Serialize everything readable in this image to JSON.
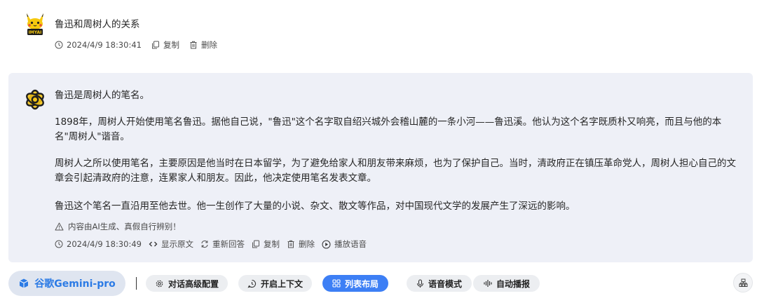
{
  "user_message": {
    "avatar_badge": "IMYAI",
    "question": "鲁迅和周树人的关系",
    "timestamp": "2024/4/9 18:30:41",
    "copy_label": "复制",
    "delete_label": "删除"
  },
  "answer": {
    "paragraphs": [
      "鲁迅是周树人的笔名。",
      "1898年，周树人开始使用笔名鲁迅。据他自己说，\"鲁迅\"这个名字取自绍兴城外会稽山麓的一条小河——鲁迅溪。他认为这个名字既质朴又响亮，而且与他的本名\"周树人\"谐音。",
      "周树人之所以使用笔名，主要原因是他当时在日本留学，为了避免给家人和朋友带来麻烦，也为了保护自己。当时，清政府正在镇压革命党人，周树人担心自己的文章会引起清政府的注意，连累家人和朋友。因此，他决定使用笔名发表文章。",
      "鲁迅这个笔名一直沿用至他去世。他一生创作了大量的小说、杂文、散文等作品，对中国现代文学的发展产生了深远的影响。"
    ],
    "disclaimer": "内容由AI生成、真假自行辨别！",
    "timestamp": "2024/4/9 18:30:49",
    "show_source_label": "显示原文",
    "regenerate_label": "重新回答",
    "copy_label": "复制",
    "delete_label": "删除",
    "play_voice_label": "播放语音"
  },
  "toolbar": {
    "model_label": "谷歌Gemini-pro",
    "config_label": "对话高级配置",
    "context_label": "开启上下文",
    "layout_label": "列表布局",
    "voice_mode_label": "语音模式",
    "autoplay_label": "自动播报"
  },
  "colors": {
    "accent": "#3d7ff5",
    "model_text": "#2c7be5",
    "card_bg": "#eef0f7",
    "bot_avatar": "#f5c518"
  },
  "icons": {
    "user_avatar": "pikachu-avatar",
    "bot_avatar": "openai-logo",
    "clock": "clock-icon",
    "copy": "copy-icon",
    "delete": "trash-icon",
    "warning": "warning-icon",
    "code": "code-icon",
    "regenerate": "refresh-icon",
    "play": "play-icon",
    "model": "cube-icon",
    "config": "gear-icon",
    "context": "chat-icon",
    "layout": "grid-icon",
    "voice": "microphone-icon",
    "autoplay": "soundwave-icon",
    "corner": "layout-icon"
  }
}
